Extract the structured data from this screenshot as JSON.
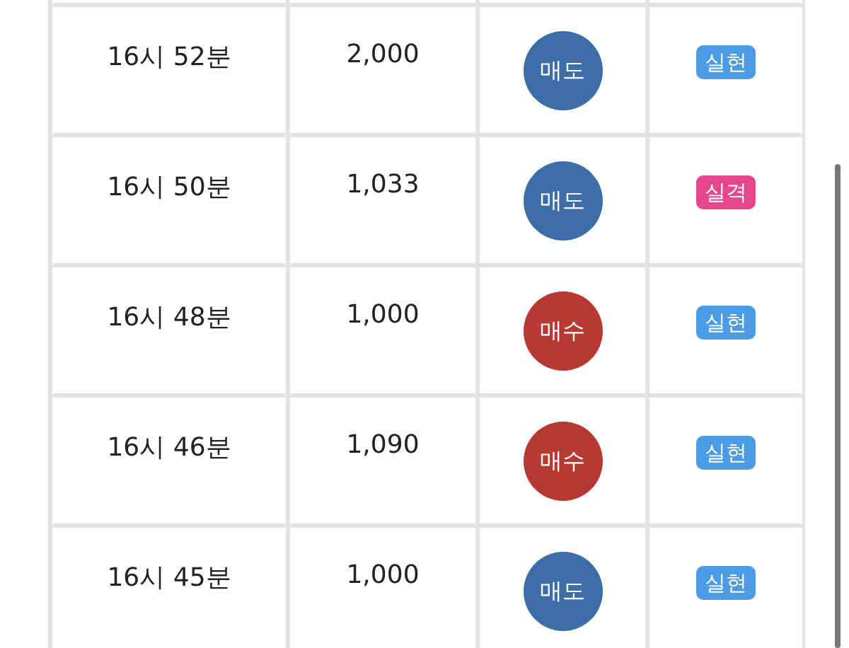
{
  "rows": [
    {
      "time": "16시 52분",
      "amount": "2,000",
      "action": {
        "label": "매도",
        "color": "#3c6ea8"
      },
      "result": {
        "label": "실현",
        "color": "#4b9be6"
      }
    },
    {
      "time": "16시 50분",
      "amount": "1,033",
      "action": {
        "label": "매도",
        "color": "#3c6ea8"
      },
      "result": {
        "label": "실격",
        "color": "#e6478c"
      }
    },
    {
      "time": "16시 48분",
      "amount": "1,000",
      "action": {
        "label": "매수",
        "color": "#b63a33"
      },
      "result": {
        "label": "실현",
        "color": "#4b9be6"
      }
    },
    {
      "time": "16시 46분",
      "amount": "1,090",
      "action": {
        "label": "매수",
        "color": "#b63a33"
      },
      "result": {
        "label": "실현",
        "color": "#4b9be6"
      }
    },
    {
      "time": "16시 45분",
      "amount": "1,000",
      "action": {
        "label": "매도",
        "color": "#3c6ea8"
      },
      "result": {
        "label": "실현",
        "color": "#4b9be6"
      }
    }
  ]
}
